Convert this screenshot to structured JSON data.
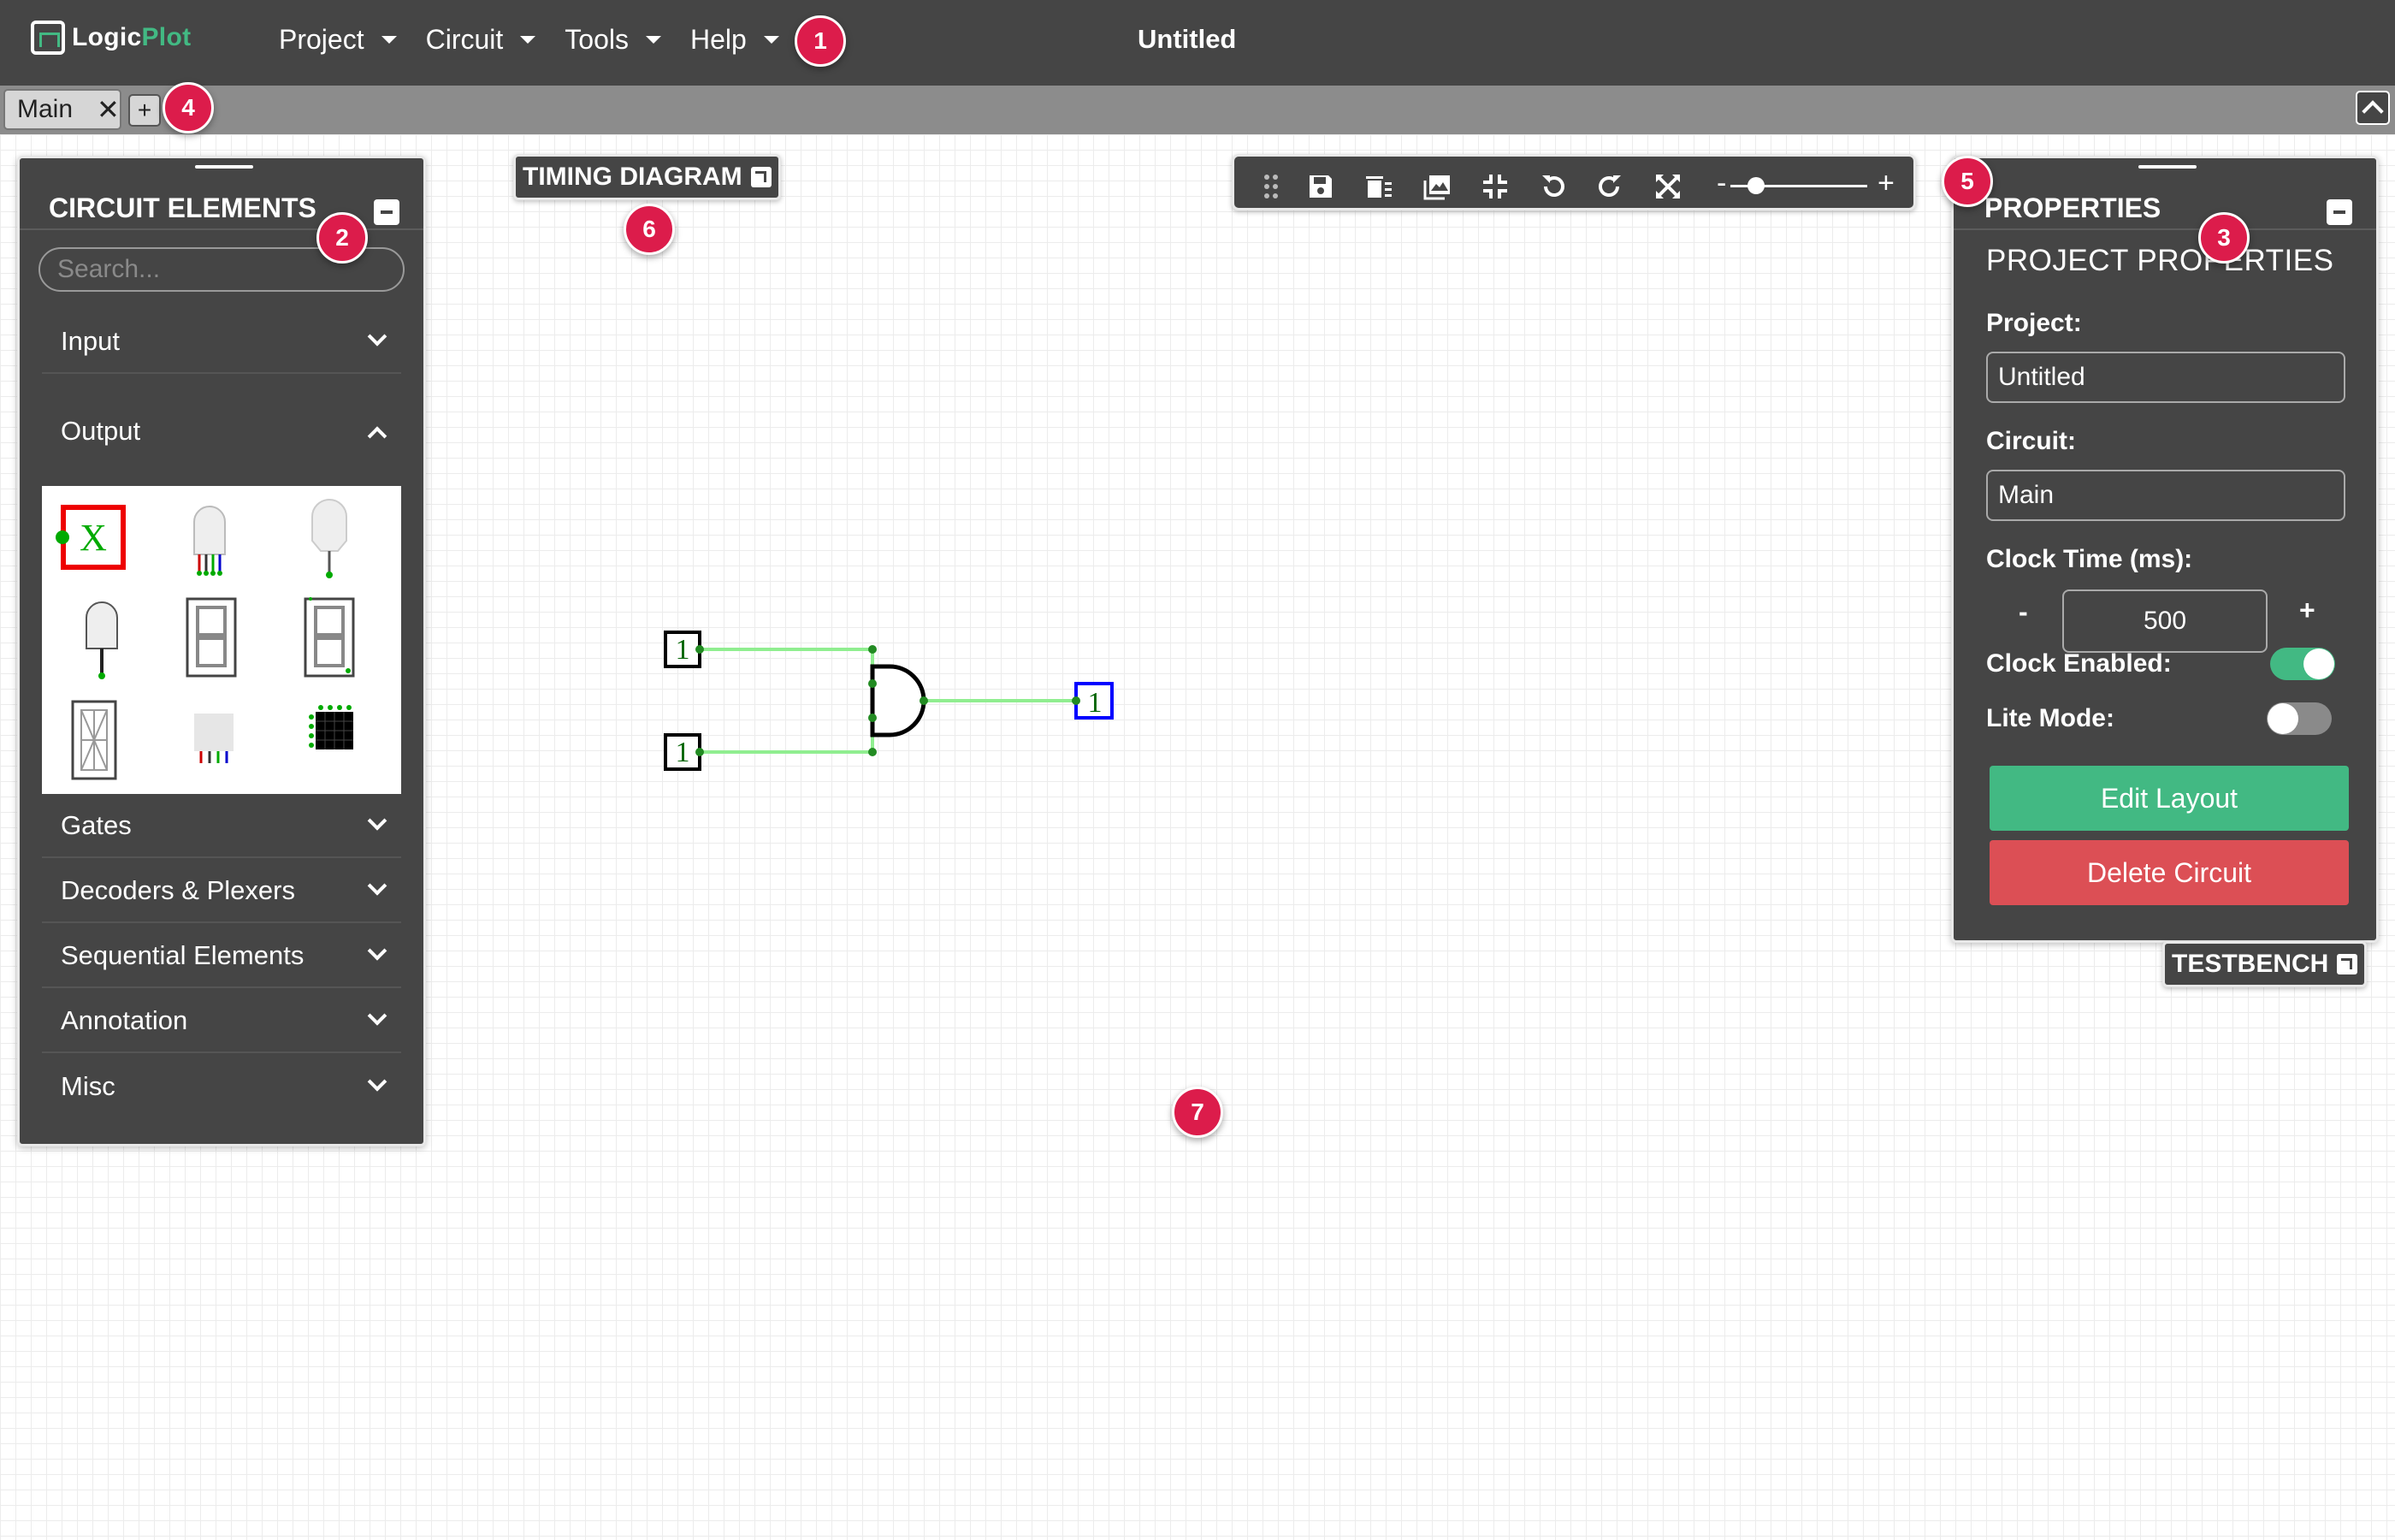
{
  "app": {
    "logo_prefix": "Logic",
    "logo_accent": "Plot",
    "doc_title": "Untitled"
  },
  "menu": [
    {
      "label": "Project"
    },
    {
      "label": "Circuit"
    },
    {
      "label": "Tools"
    },
    {
      "label": "Help"
    }
  ],
  "tabs": [
    {
      "label": "Main",
      "close": "✕"
    }
  ],
  "tab_add_label": "+",
  "badges": [
    "1",
    "2",
    "3",
    "4",
    "5",
    "6",
    "7"
  ],
  "elements_panel": {
    "title": "CIRCUIT ELEMENTS",
    "search_placeholder": "Search...",
    "categories": [
      {
        "label": "Input",
        "expanded": false
      },
      {
        "label": "Output",
        "expanded": true
      },
      {
        "label": "Gates",
        "expanded": false
      },
      {
        "label": "Decoders & Plexers",
        "expanded": false
      },
      {
        "label": "Sequential Elements",
        "expanded": false
      },
      {
        "label": "Annotation",
        "expanded": false
      },
      {
        "label": "Misc",
        "expanded": false
      }
    ],
    "output_items": [
      "probe",
      "rgb-led",
      "led",
      "digital-led",
      "seven-segment",
      "seven-segment-dp",
      "sixteen-segment",
      "square-rgb-led",
      "rgb-led-matrix"
    ],
    "probe_label": "X"
  },
  "timing_diagram": {
    "label": "TIMING DIAGRAM"
  },
  "testbench": {
    "label": "TESTBENCH"
  },
  "toolbar": {
    "icons": [
      "drag-handle-icon",
      "save-icon",
      "delete-icon",
      "image-icon",
      "fit-icon",
      "undo-icon",
      "redo-icon",
      "fullscreen-icon"
    ],
    "zoom_minus": "-",
    "zoom_plus": "+"
  },
  "properties": {
    "title": "PROPERTIES",
    "subtitle": "PROJECT PROPERTIES",
    "project_label": "Project:",
    "project_value": "Untitled",
    "circuit_label": "Circuit:",
    "circuit_value": "Main",
    "clock_time_label": "Clock Time (ms):",
    "clock_time_value": "500",
    "stepper_minus": "-",
    "stepper_plus": "+",
    "clock_enabled_label": "Clock Enabled:",
    "clock_enabled": true,
    "lite_mode_label": "Lite Mode:",
    "lite_mode": false,
    "edit_layout": "Edit Layout",
    "delete_circuit": "Delete Circuit"
  },
  "circuit": {
    "inputs": [
      "1",
      "1"
    ],
    "output": "1",
    "gate": "AND",
    "wire_color": "#90ee90"
  },
  "colors": {
    "accent": "#42b983",
    "danger": "#dc4f55",
    "badge": "#dc1c4b",
    "panel": "#454545"
  }
}
